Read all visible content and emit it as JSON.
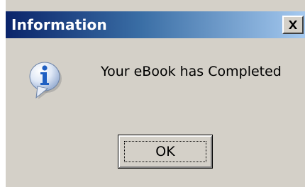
{
  "dialog": {
    "title": "Information",
    "message": "Your eBook has Completed",
    "icon": "info-icon",
    "buttons": {
      "ok_label": "OK"
    },
    "titlebar": {
      "close_icon": "close-icon"
    }
  },
  "colors": {
    "titlebar_start": "#0a246a",
    "titlebar_end": "#a6caf0",
    "window_bg": "#d4d0c8",
    "icon_blue": "#1f5fc2"
  }
}
